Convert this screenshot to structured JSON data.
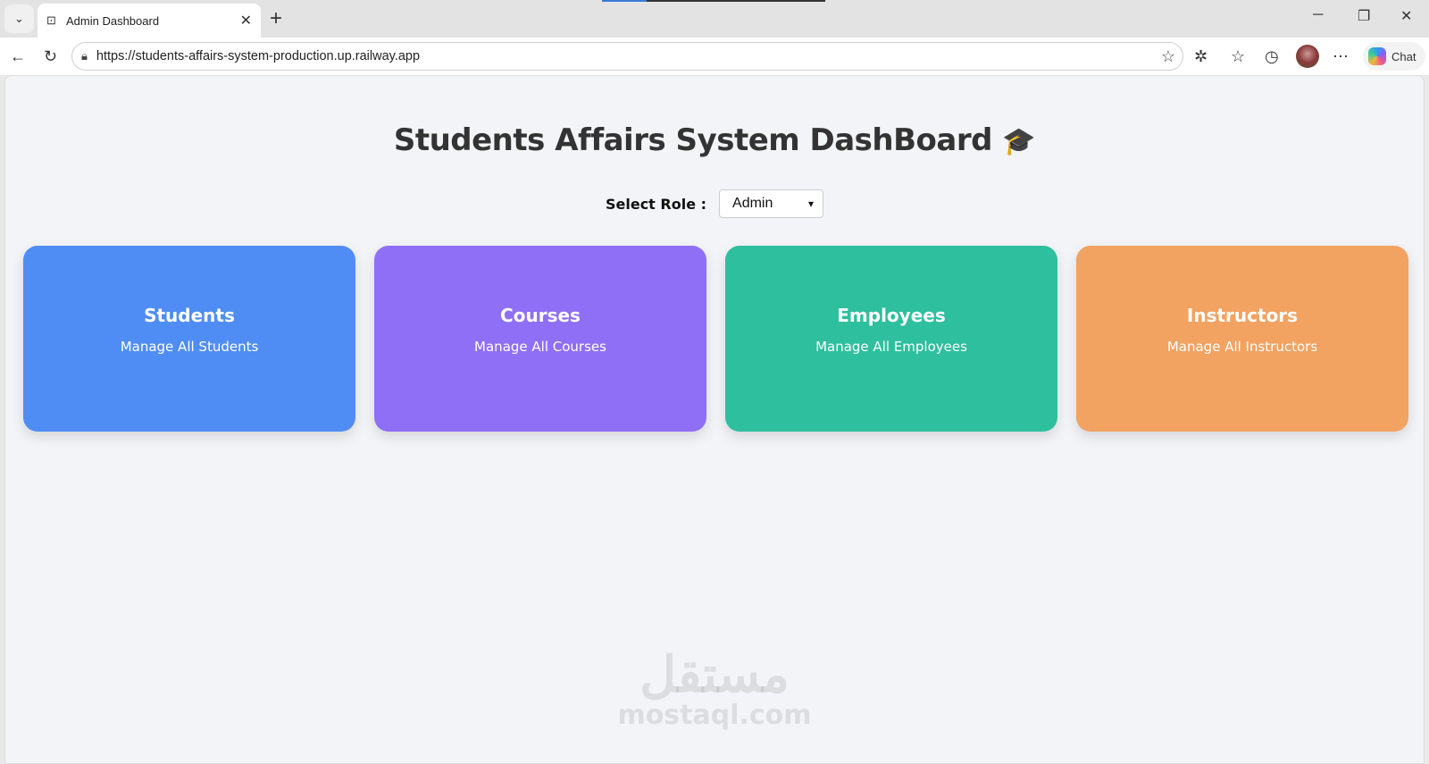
{
  "browser": {
    "tab_title": "Admin Dashboard",
    "url": "https://students-affairs-system-production.up.railway.app",
    "chat_label": "Chat"
  },
  "page": {
    "title": "Students Affairs System DashBoard",
    "title_emoji": "🎓",
    "role_label": "Select Role :",
    "role_value": "Admin",
    "cards": [
      {
        "title": "Students",
        "subtitle": "Manage All Students",
        "color": "#4f8df5"
      },
      {
        "title": "Courses",
        "subtitle": "Manage All Courses",
        "color": "#8f6ff6"
      },
      {
        "title": "Employees",
        "subtitle": "Manage All Employees",
        "color": "#2ebf9e"
      },
      {
        "title": "Instructors",
        "subtitle": "Manage All Instructors",
        "color": "#f2a261"
      }
    ]
  },
  "watermark": {
    "arabic": "مستقل",
    "latin": "mostaql.com"
  }
}
